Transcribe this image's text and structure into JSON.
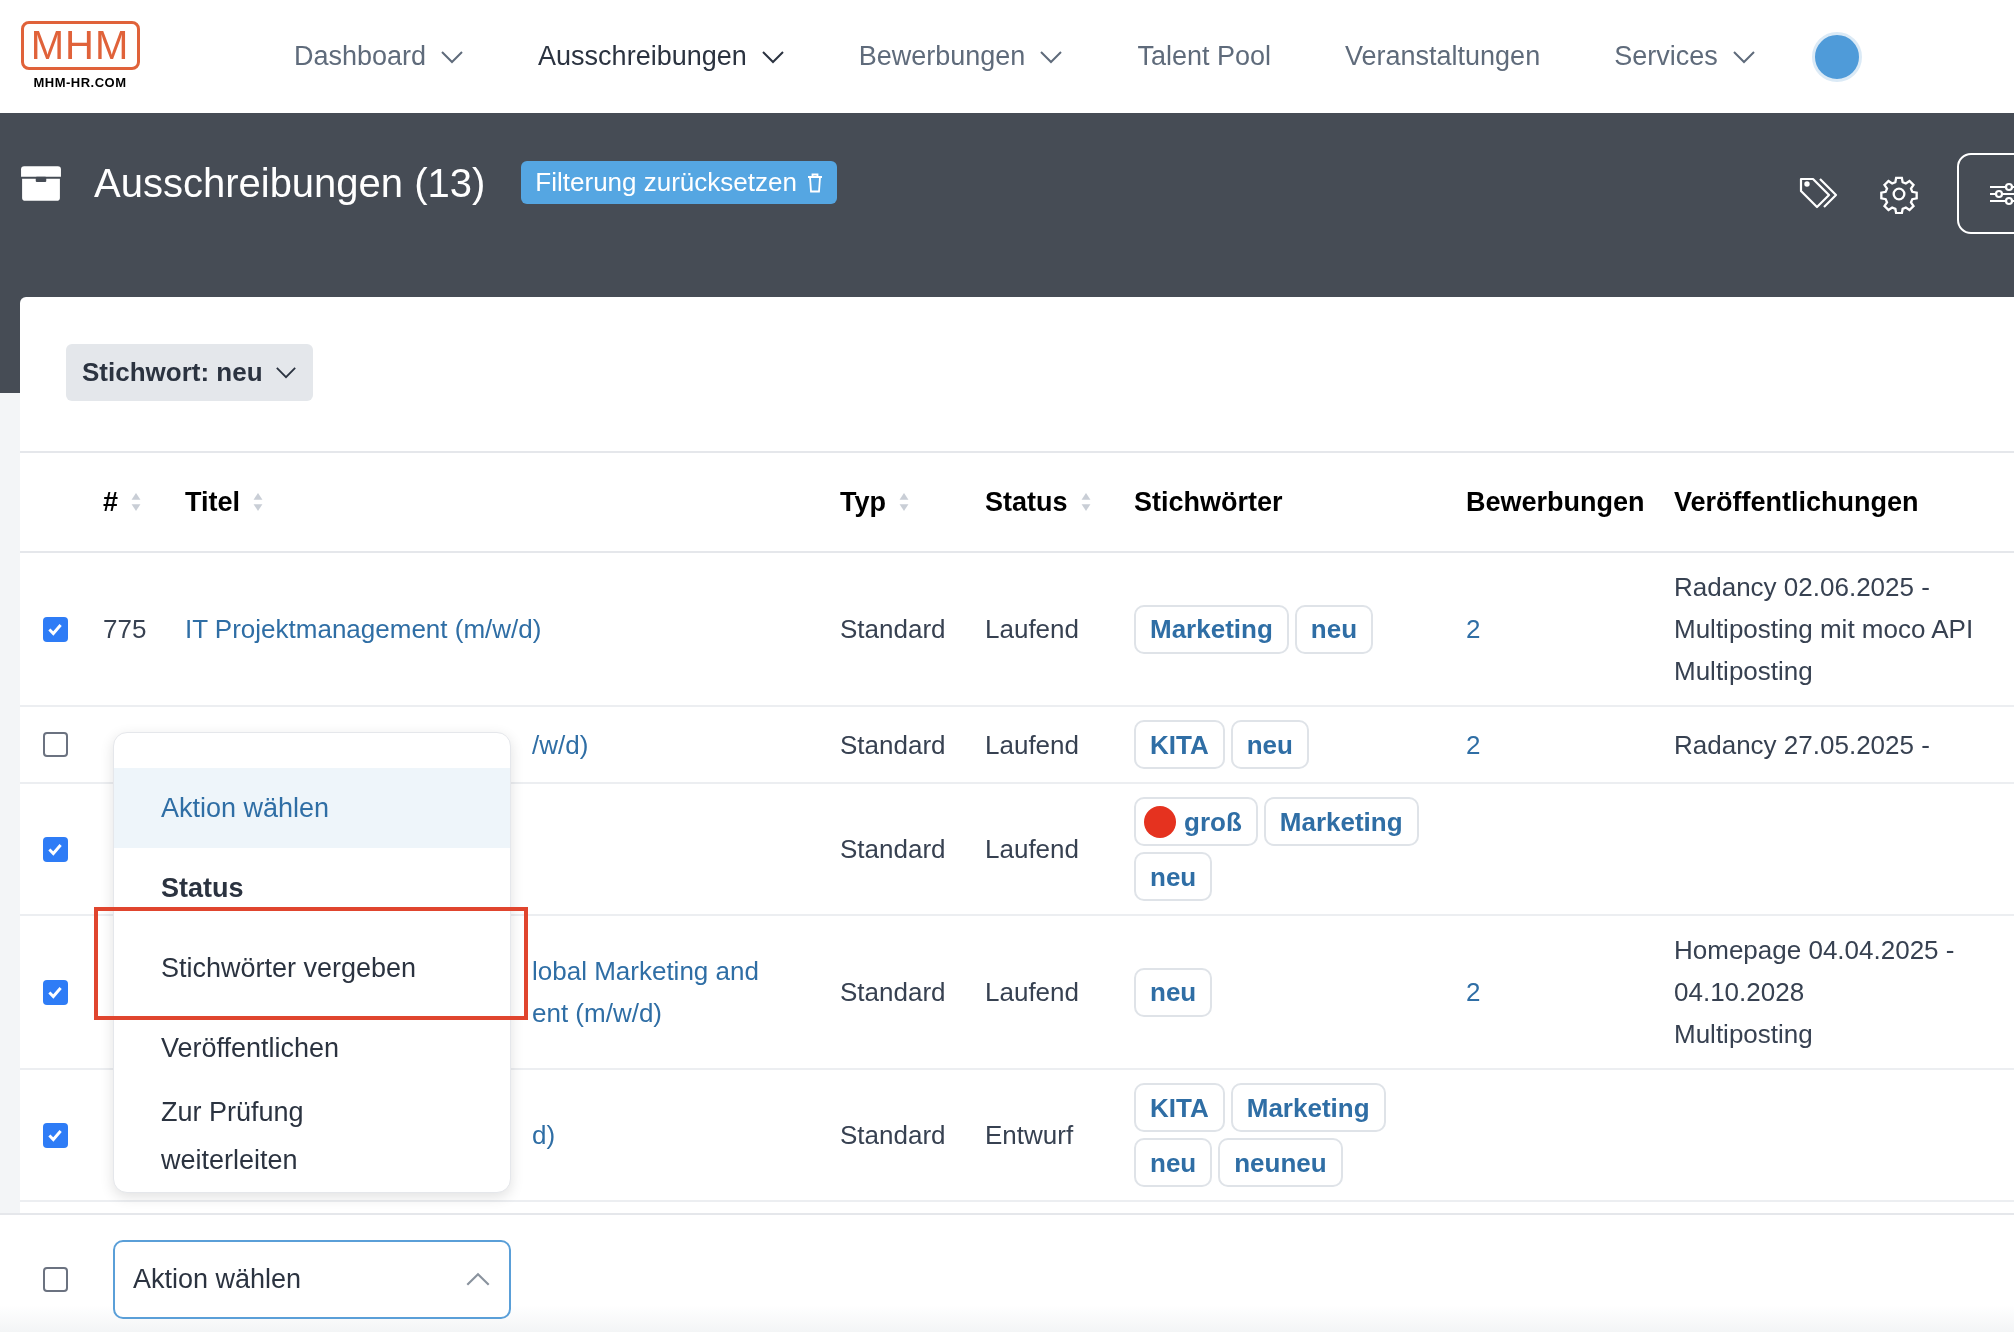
{
  "logo": {
    "mark": "MHM",
    "caption": "MHM-HR.COM"
  },
  "nav": [
    {
      "label": "Dashboard",
      "has_menu": true,
      "selected": false
    },
    {
      "label": "Ausschreibungen",
      "has_menu": true,
      "selected": true
    },
    {
      "label": "Bewerbungen",
      "has_menu": true,
      "selected": false
    },
    {
      "label": "Talent Pool",
      "has_menu": false,
      "selected": false
    },
    {
      "label": "Veranstaltungen",
      "has_menu": false,
      "selected": false
    },
    {
      "label": "Services",
      "has_menu": true,
      "selected": false
    }
  ],
  "page_title": "Ausschreibungen (13)",
  "reset_filter_button": "Filterung zurücksetzen",
  "filter_chip": "Stichwort: neu",
  "table": {
    "columns": [
      {
        "label": "#",
        "sortable": true
      },
      {
        "label": "Titel",
        "sortable": true
      },
      {
        "label": "Typ",
        "sortable": true
      },
      {
        "label": "Status",
        "sortable": true
      },
      {
        "label": "Stichwörter"
      },
      {
        "label": "Bewerbungen"
      },
      {
        "label": "Veröffentlichungen"
      }
    ],
    "rows": [
      {
        "checked": true,
        "number": "775",
        "title_lines": [
          "IT Projektmanagement (m/w/d)"
        ],
        "type": "Standard",
        "status": "Laufend",
        "tags": [
          {
            "label": "Marketing"
          },
          {
            "label": "neu"
          }
        ],
        "applications": "2",
        "publications": [
          "Radancy 02.06.2025 -",
          "Multiposting mit moco API",
          "Multiposting"
        ]
      },
      {
        "checked": false,
        "title_lines": [
          "/w/d)"
        ],
        "type": "Standard",
        "status": "Laufend",
        "tags": [
          {
            "label": "KITA"
          },
          {
            "label": "neu"
          }
        ],
        "applications": "2",
        "publications": [
          "Radancy 27.05.2025 -"
        ]
      },
      {
        "checked": true,
        "title_lines": [],
        "type": "Standard",
        "status": "Laufend",
        "tags": [
          {
            "label": "groß",
            "color": "#e5321f"
          },
          {
            "label": "Marketing"
          },
          {
            "label": "neu"
          }
        ],
        "publications": []
      },
      {
        "checked": true,
        "title_lines": [
          "lobal Marketing and",
          "ent (m/w/d)"
        ],
        "type": "Standard",
        "status": "Laufend",
        "tags": [
          {
            "label": "neu"
          }
        ],
        "applications": "2",
        "publications": [
          "Homepage 04.04.2025 -",
          "04.10.2028",
          "Multiposting"
        ]
      },
      {
        "checked": true,
        "title_lines": [
          "d)"
        ],
        "type": "Standard",
        "status": "Entwurf",
        "tags": [
          {
            "label": "KITA"
          },
          {
            "label": "Marketing"
          },
          {
            "label": "neu"
          },
          {
            "label": "neuneu"
          }
        ],
        "publications": []
      }
    ]
  },
  "action_menu": {
    "items": [
      {
        "kind": "option",
        "label": "Aktion wählen",
        "selected": true
      },
      {
        "kind": "group",
        "label": "Status"
      },
      {
        "kind": "option",
        "label": "Stichwörter vergeben",
        "selected": false
      },
      {
        "kind": "option",
        "label": "Veröffentlichen",
        "selected": false
      },
      {
        "kind": "option",
        "label": "Zur Prüfung weiterleiten",
        "selected": false
      }
    ]
  },
  "footer": {
    "select_all_checked": false,
    "action_select": "Aktion wählen",
    "expanded": true
  }
}
